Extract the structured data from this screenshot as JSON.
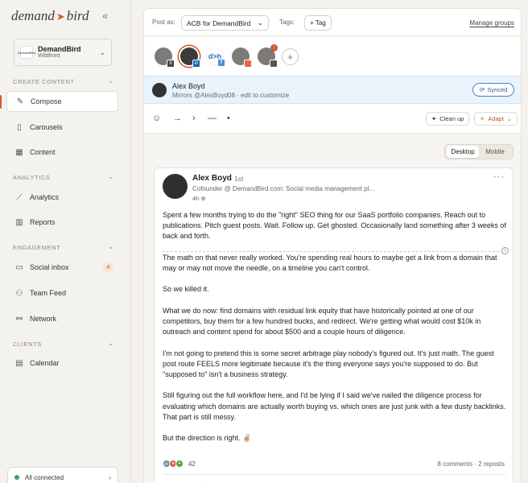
{
  "brand": {
    "name_left": "demand",
    "arrow": "➤",
    "name_right": "bird",
    "collapse": "«"
  },
  "workspace": {
    "logo_text": "DemandBird",
    "name": "DemandBird",
    "sub": "Wildfront"
  },
  "sidebar": {
    "sections": {
      "create": "CREATE CONTENT",
      "analytics": "ANALYTICS",
      "engagement": "ENGAGEMENT",
      "clients": "CLIENTS"
    },
    "items": {
      "compose": "Compose",
      "carousels": "Carousels",
      "content": "Content",
      "analytics": "Analytics",
      "reports": "Reports",
      "social_inbox": "Social inbox",
      "social_inbox_badge": "4",
      "team_feed": "Team Feed",
      "network": "Network",
      "calendar": "Calendar"
    },
    "status": "All connected"
  },
  "topbar": {
    "post_as_label": "Post as:",
    "post_as_value": "ACB for DemandBird",
    "tags_label": "Tags:",
    "tag_button": "+ Tag",
    "manage_groups": "Manage groups"
  },
  "accounts": [
    {
      "initials": "",
      "network": "X"
    },
    {
      "initials": "",
      "network": "in"
    },
    {
      "initials": "d>h",
      "network": "f"
    },
    {
      "initials": "",
      "network": ""
    },
    {
      "initials": "",
      "network": ""
    }
  ],
  "mirror": {
    "name": "Alex Boyd",
    "sub": "Mirrors @AlexBoyd08 · edit to customize",
    "synced": "Synced"
  },
  "toolbar": {
    "clean_up": "Clean up",
    "adapt": "Adapt"
  },
  "view_toggle": {
    "desktop": "Desktop",
    "mobile": "Mobile"
  },
  "post": {
    "author": "Alex Boyd",
    "degree": "· 1st",
    "headline": "Cofounder @ DemandBird.com: Social media management pl...",
    "time": "4h",
    "paragraphs": [
      "Spent a few months trying to do the \"right\" SEO thing for our SaaS portfolio companies. Reach out to publications. Pitch guest posts. Wait. Follow up. Get ghosted. Occasionally land something after 3 weeks of back and forth.",
      "The math on that never really worked. You're spending real hours to maybe get a link from a domain that may or may not move the needle, on a timeline you can't control.",
      "So we killed it.",
      "What we do now: find domains with residual link equity that have historically pointed at one of our competitors, buy them for a few hundred bucks, and redirect. We're getting what would cost $10k in outreach and content spend for about $500 and a couple hours of diligence.",
      "I'm not going to pretend this is some secret arbitrage play nobody's figured out. It's just math. The guest post route FEELS more legitimate because it's the thing everyone says you're supposed to do. But \"supposed to\" isn't a business strategy.",
      "Still figuring out the full workflow here, and I'd be lying if I said we've nailed the diligence process for evaluating which domains are actually worth buying vs. which ones are just junk with a few dusty backlinks. That part is still messy.",
      "But the direction is right. ✌🏼"
    ],
    "reaction_count": "42",
    "stats": "8 comments · 2 reposts"
  },
  "colors": {
    "accent": "#d4582b",
    "synced": "#2d5e9a",
    "connected": "#3aa55c"
  }
}
